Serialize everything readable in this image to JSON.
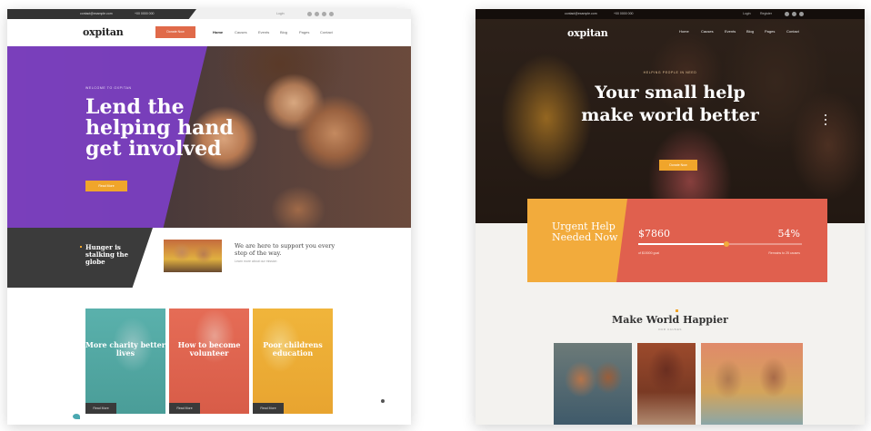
{
  "left_page": {
    "topbar": {
      "email": "contact@example.com",
      "phone": "+00 0000 000",
      "login": "Login"
    },
    "header": {
      "logo": "oxpitan",
      "cta": "Donate Now",
      "nav": [
        "Home",
        "Causes",
        "Events",
        "Blog",
        "Pages",
        "Contact"
      ]
    },
    "hero": {
      "eyebrow": "WELCOME TO OXPITAN",
      "title": "Lend the helping hand get involved",
      "button": "Read More"
    },
    "strip": {
      "hunger": "Hunger is stalking the globe",
      "support": "We are here to support you every step of the way.",
      "link": "Learn more about our mission"
    },
    "cards": [
      {
        "title": "More charity better lives",
        "button": "Read More"
      },
      {
        "title": "How to become volunteer",
        "button": "Read More"
      },
      {
        "title": "Poor childrens education",
        "button": "Read More"
      }
    ]
  },
  "right_page": {
    "topbar": {
      "email": "contact@example.com",
      "phone": "+00 0000 000",
      "login": "Login",
      "register": "Register"
    },
    "header": {
      "logo": "oxpitan",
      "nav": [
        "Home",
        "Causes",
        "Events",
        "Blog",
        "Pages",
        "Contact"
      ]
    },
    "hero": {
      "eyebrow": "HELPING PEOPLE IN NEED",
      "title": "Your small help make world better",
      "button": "Donate Now"
    },
    "urgent": {
      "title": "Urgent Help Needed Now",
      "amount": "$7860",
      "percent": "54%",
      "progress": 0.54,
      "goal": "of $15000 goal",
      "remaining": "Remains to 25 causes"
    },
    "section": {
      "heading": "Make World Happier",
      "sub": "OUR CAUSES"
    }
  },
  "colors": {
    "purple": "#7a3ebf",
    "orange": "#f0a52b",
    "coral": "#e0604e",
    "teal": "#5ab1ac",
    "dark": "#3b3b3b"
  }
}
